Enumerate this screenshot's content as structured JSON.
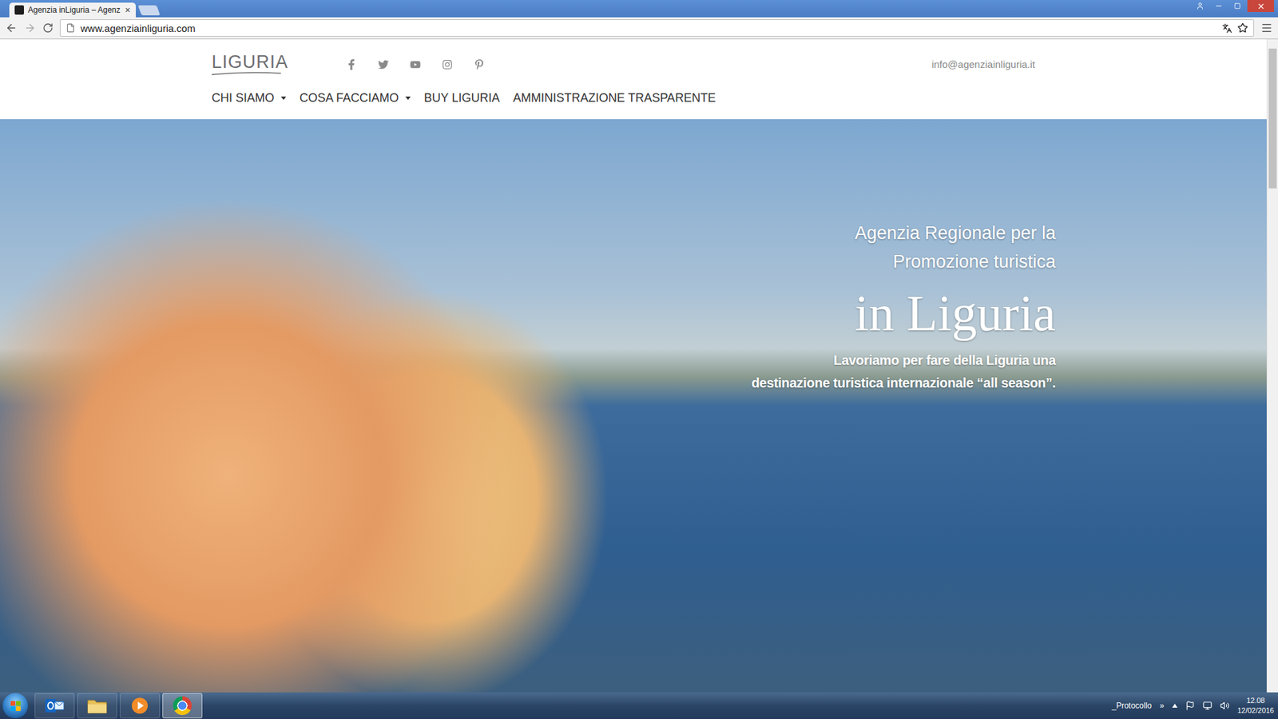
{
  "browser": {
    "tabs": [
      {
        "label": "Agenzia inLiguria – Agenz",
        "close": "×",
        "selected": true
      }
    ],
    "address": "www.agenziainliguria.com"
  },
  "site": {
    "logo": "LIGURIA",
    "email": "info@agenziainliguria.it",
    "nav": [
      {
        "label": "CHI SIAMO",
        "dropdown": true
      },
      {
        "label": "COSA FACCIAMO",
        "dropdown": true
      },
      {
        "label": "BUY LIGURIA",
        "dropdown": false
      },
      {
        "label": "AMMINISTRAZIONE TRASPARENTE",
        "dropdown": false
      }
    ],
    "hero": {
      "kicker": [
        "Agenzia Regionale per la",
        "Promozione turistica"
      ],
      "title": "in Liguria",
      "tagline": [
        "Lavoriamo per fare della Liguria una",
        "destinazione turistica internazionale “all season”."
      ]
    }
  },
  "scrollbar": {
    "level": 0.22
  },
  "taskbar": {
    "apps": [
      {
        "kind": "outlook",
        "selected": false
      },
      {
        "kind": "explorer",
        "selected": false
      },
      {
        "kind": "media",
        "selected": false
      },
      {
        "kind": "chrome",
        "selected": true
      }
    ],
    "toolbar": "_Protocollo",
    "overflow": "»",
    "time": "12.08",
    "date": "12/02/2016"
  }
}
